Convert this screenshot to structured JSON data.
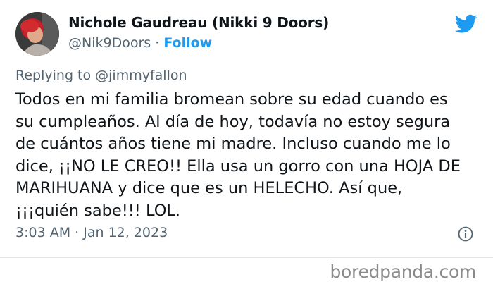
{
  "tweet": {
    "author_name": "Nichole Gaudreau (Nikki 9 Doors)",
    "handle": "@Nik9Doors",
    "separator": "·",
    "follow_label": "Follow",
    "replying_prefix": "Replying to ",
    "replying_to": "@jimmyfallon",
    "text": "Todos en mi familia bromean sobre su edad cuando es\nsu cumpleaños. Al día de hoy, todavía no estoy segura\nde cuántos años tiene mi madre. Incluso cuando me lo\ndice, ¡¡NO LE CREO!! Ella usa un gorro con una HOJA DE\nMARIHUANA y dice que es un HELECHO. Así que,\n¡¡¡quién sabe!!! LOL.",
    "time": "3:03 AM",
    "date": "Jan 12, 2023"
  },
  "icons": {
    "logo": "twitter-bird-icon",
    "info": "info-icon"
  },
  "colors": {
    "accent": "#1d9bf0",
    "secondary_text": "#536471",
    "primary_text": "#0f1419"
  },
  "watermark": "boredpanda.com"
}
